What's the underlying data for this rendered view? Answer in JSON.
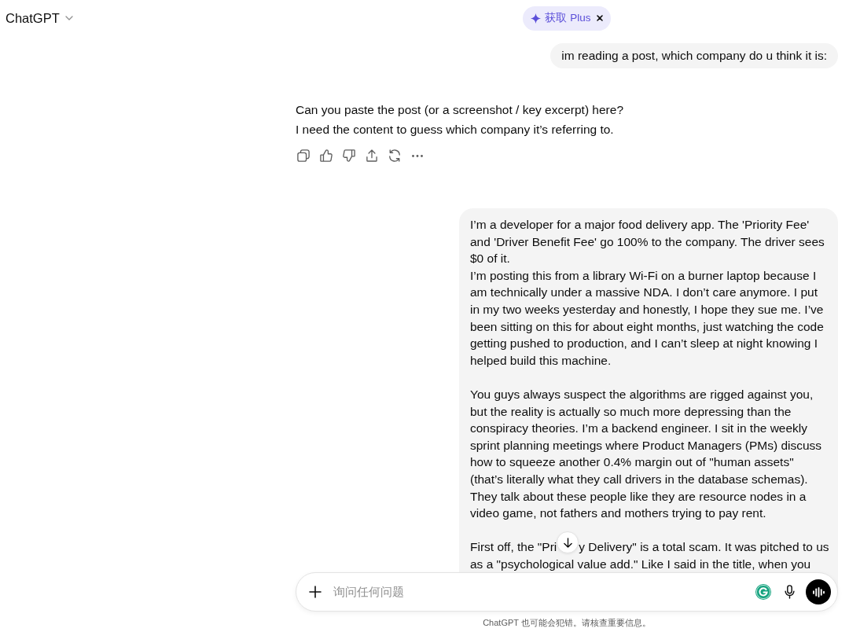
{
  "header": {
    "model_menu": {
      "label": "ChatGPT"
    },
    "upgrade_pill": {
      "label": "获取 Plus"
    }
  },
  "messages": [
    {
      "kind": "user",
      "paragraphs": [
        {
          "text": "im reading a post, which company do u think it is:"
        }
      ]
    },
    {
      "kind": "assistant",
      "paragraphs": [
        {
          "text": "Can you paste the post (or a screenshot / key excerpt) here?"
        },
        {
          "text": "I need the content to guess which company it’s referring to."
        }
      ]
    },
    {
      "kind": "user",
      "paragraphs": [
        {
          "text": "I’m a developer for a major food delivery app. The 'Priority Fee' and 'Driver Benefit Fee' go 100% to the company. The driver sees $0 of it.\nI’m posting this from a library Wi-Fi on a burner laptop because I am technically under a massive NDA. I don’t care anymore. I put in my two weeks yesterday and honestly, I hope they sue me. I’ve been sitting on this for about eight months, just watching the code getting pushed to production, and I can’t sleep at night knowing I helped build this machine."
        },
        {
          "text": "You guys always suspect the algorithms are rigged against you, but the reality is actually so much more depressing than the conspiracy theories. I’m a backend engineer. I sit in the weekly sprint planning meetings where Product Managers (PMs) discuss how to squeeze another 0.4% margin out of \"human assets\" (that’s literally what they call drivers in the database schemas). They talk about these people like they are resource nodes in a video game, not fathers and mothers trying to pay rent."
        },
        {
          "text": "First off, the \"Pri",
          "text_after_overlap": "y Delivery\" is a total scam. It was pitched to us",
          "text_continued": "as a \"psychological value add.\" Like I said in the title, when you"
        }
      ]
    }
  ],
  "composer": {
    "placeholder": "询问任何问题"
  },
  "disclaimer": "ChatGPT 也可能会犯错。请核查重要信息。"
}
